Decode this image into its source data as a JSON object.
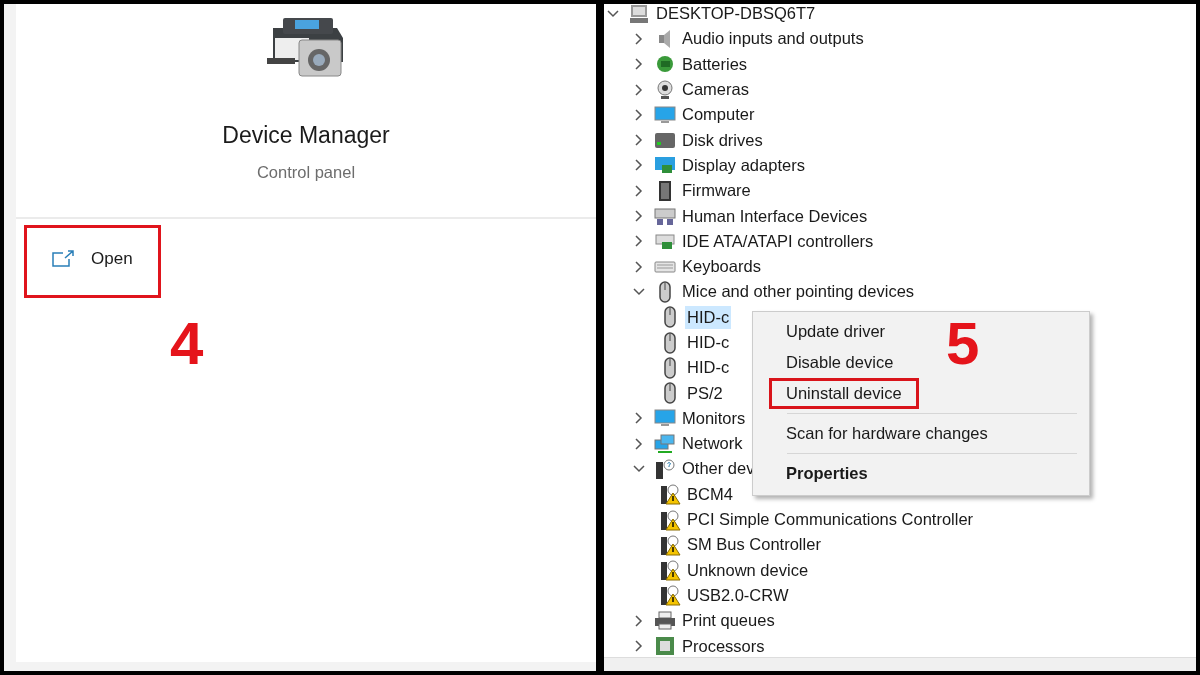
{
  "app_card": {
    "title": "Device Manager",
    "subtitle": "Control panel",
    "actions": [
      {
        "label": "Open",
        "annotated": true
      }
    ],
    "step": "4"
  },
  "device_tree": {
    "root": {
      "label": "DESKTOP-DBSQ6T7",
      "expanded": true,
      "children": [
        {
          "label": "Audio inputs and outputs",
          "expanded": false
        },
        {
          "label": "Batteries",
          "expanded": false
        },
        {
          "label": "Cameras",
          "expanded": false
        },
        {
          "label": "Computer",
          "expanded": false
        },
        {
          "label": "Disk drives",
          "expanded": false
        },
        {
          "label": "Display adapters",
          "expanded": false
        },
        {
          "label": "Firmware",
          "expanded": false
        },
        {
          "label": "Human Interface Devices",
          "expanded": false
        },
        {
          "label": "IDE ATA/ATAPI controllers",
          "expanded": false
        },
        {
          "label": "Keyboards",
          "expanded": false
        },
        {
          "label": "Mice and other pointing devices",
          "expanded": true,
          "children": [
            {
              "label": "HID-c",
              "selected": true
            },
            {
              "label": "HID-c",
              "selected": false
            },
            {
              "label": "HID-c",
              "selected": false
            },
            {
              "label": "PS/2",
              "selected": false
            }
          ]
        },
        {
          "label": "Monitors",
          "expanded": false
        },
        {
          "label": "Network",
          "expanded": false
        },
        {
          "label": "Other dev",
          "expanded": true,
          "children": [
            {
              "label": "BCM4",
              "selected": false
            },
            {
              "label": "PCI Simple Communications Controller",
              "selected": false
            },
            {
              "label": "SM Bus Controller",
              "selected": false
            },
            {
              "label": "Unknown device",
              "selected": false
            },
            {
              "label": "USB2.0-CRW",
              "selected": false
            }
          ]
        },
        {
          "label": "Print queues",
          "expanded": false
        },
        {
          "label": "Processors",
          "expanded": false
        }
      ]
    }
  },
  "context_menu": {
    "items": [
      {
        "kind": "item",
        "label": "Update driver",
        "default": false,
        "annotated": false
      },
      {
        "kind": "item",
        "label": "Disable device",
        "default": false,
        "annotated": false
      },
      {
        "kind": "item",
        "label": "Uninstall device",
        "default": false,
        "annotated": true
      },
      {
        "kind": "separator"
      },
      {
        "kind": "item",
        "label": "Scan for hardware changes",
        "default": false,
        "annotated": false
      },
      {
        "kind": "separator"
      },
      {
        "kind": "item",
        "label": "Properties",
        "default": true,
        "annotated": false
      }
    ],
    "step": "5"
  }
}
